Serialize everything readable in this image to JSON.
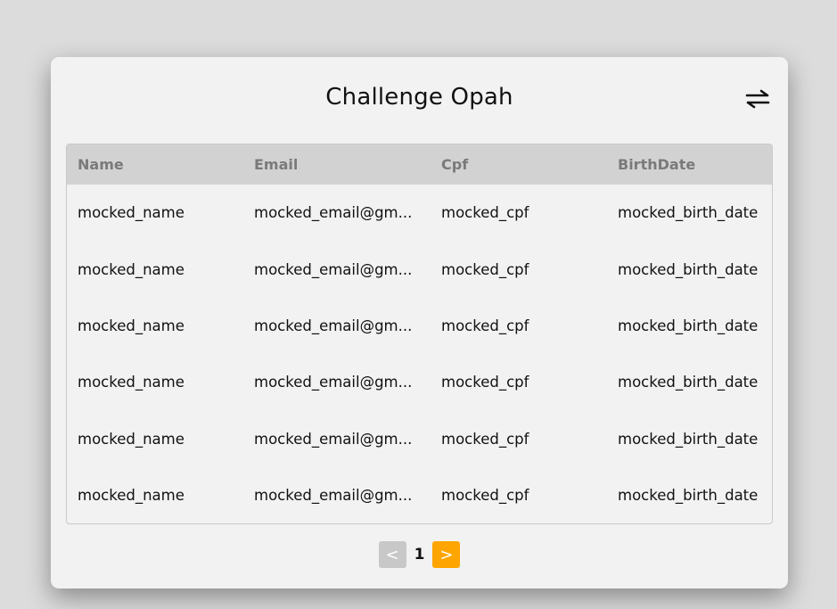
{
  "header": {
    "title": "Challenge Opah",
    "swap_icon": "swap-arrows-icon"
  },
  "table": {
    "columns": [
      "Name",
      "Email",
      "Cpf",
      "BirthDate"
    ],
    "rows": [
      [
        "mocked_name",
        "mocked_email@gm...",
        "mocked_cpf",
        "mocked_birth_date"
      ],
      [
        "mocked_name",
        "mocked_email@gm...",
        "mocked_cpf",
        "mocked_birth_date"
      ],
      [
        "mocked_name",
        "mocked_email@gm...",
        "mocked_cpf",
        "mocked_birth_date"
      ],
      [
        "mocked_name",
        "mocked_email@gm...",
        "mocked_cpf",
        "mocked_birth_date"
      ],
      [
        "mocked_name",
        "mocked_email@gm...",
        "mocked_cpf",
        "mocked_birth_date"
      ],
      [
        "mocked_name",
        "mocked_email@gm...",
        "mocked_cpf",
        "mocked_birth_date"
      ]
    ]
  },
  "pagination": {
    "prev_label": "<",
    "current_page": "1",
    "next_label": ">"
  },
  "colors": {
    "background": "#dcdcdc",
    "card": "#f2f2f2",
    "table_header": "#d2d2d2",
    "next_button": "#ffa500",
    "prev_button": "#c8c8c8"
  }
}
